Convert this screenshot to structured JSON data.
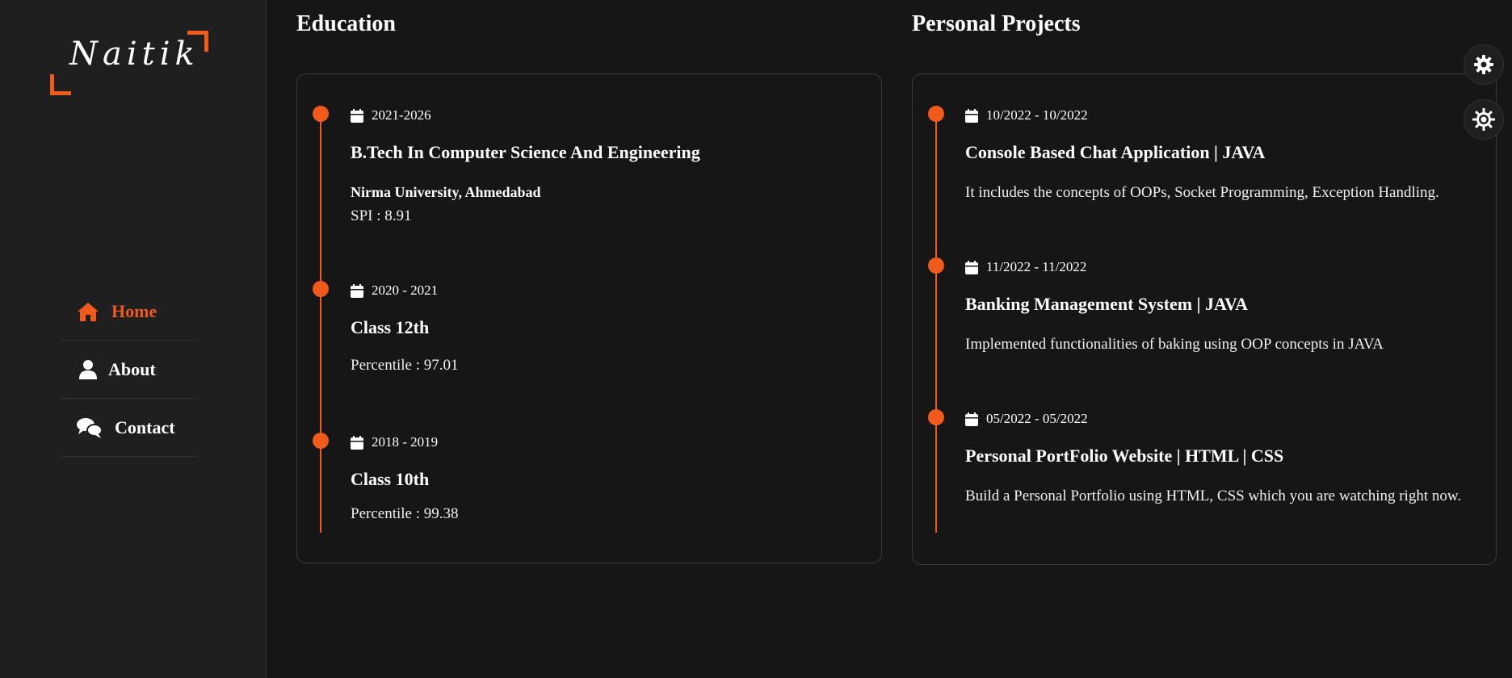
{
  "logo": {
    "text": "Naitik"
  },
  "nav": [
    {
      "label": "Home",
      "icon": "home-icon",
      "active": true
    },
    {
      "label": "About",
      "icon": "user-icon",
      "active": false
    },
    {
      "label": "Contact",
      "icon": "chat-icon",
      "active": false
    }
  ],
  "education": {
    "title": "Education",
    "entries": [
      {
        "date": "2021-2026",
        "title": "B.Tech In Computer Science And Engineering",
        "subtitle": "Nirma University, Ahmedabad",
        "text": "SPI : 8.91"
      },
      {
        "date": "2020 - 2021",
        "title": "Class 12th",
        "text": "Percentile : 97.01"
      },
      {
        "date": "2018 - 2019",
        "title": "Class 10th",
        "text": "Percentile : 99.38"
      }
    ]
  },
  "projects": {
    "title": "Personal Projects",
    "entries": [
      {
        "date": "10/2022 - 10/2022",
        "title": "Console Based Chat Application | JAVA",
        "text": "It includes the concepts of OOPs, Socket Programming, Exception Handling."
      },
      {
        "date": "11/2022 - 11/2022",
        "title": "Banking Management System | JAVA",
        "text": "Implemented functionalities of baking using OOP concepts in JAVA"
      },
      {
        "date": "05/2022 - 05/2022",
        "title": "Personal PortFolio Website | HTML | CSS",
        "text": "Build a Personal Portfolio using HTML, CSS which you are watching right now."
      }
    ]
  },
  "colors": {
    "accent": "#f05a1a",
    "background": "#161616",
    "sidebar": "#1f1f1f"
  },
  "floating": [
    {
      "icon": "gear-icon"
    },
    {
      "icon": "theme-icon"
    }
  ]
}
